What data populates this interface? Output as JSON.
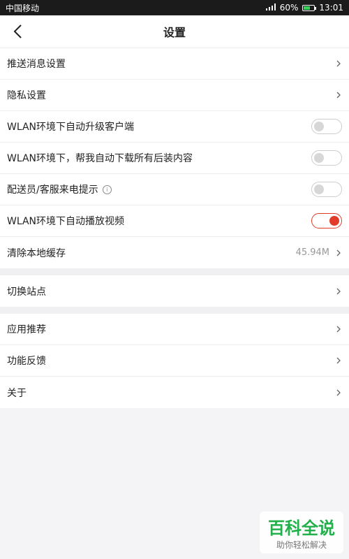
{
  "status": {
    "carrier": "中国移动",
    "battery": "60%",
    "time": "13:01",
    "battery_fill": 0.6
  },
  "header": {
    "title": "设置"
  },
  "group1": [
    {
      "label": "推送消息设置",
      "type": "nav"
    },
    {
      "label": "隐私设置",
      "type": "nav"
    },
    {
      "label": "WLAN环境下自动升级客户端",
      "type": "toggle",
      "on": false
    },
    {
      "label": "WLAN环境下，帮我自动下载所有后装内容",
      "type": "toggle",
      "on": false
    },
    {
      "label": "配送员/客服来电提示",
      "type": "toggle",
      "on": false,
      "info": true
    },
    {
      "label": "WLAN环境下自动播放视频",
      "type": "toggle",
      "on": true
    },
    {
      "label": "清除本地缓存",
      "type": "nav",
      "value": "45.94M"
    }
  ],
  "group2": [
    {
      "label": "切换站点",
      "type": "nav"
    }
  ],
  "group3": [
    {
      "label": "应用推荐",
      "type": "nav"
    },
    {
      "label": "功能反馈",
      "type": "nav"
    },
    {
      "label": "关于",
      "type": "nav"
    }
  ],
  "watermark": {
    "main": "百科全说",
    "sub": "助你轻松解决"
  },
  "colors": {
    "accent": "#e23b2a",
    "brand": "#22b04b"
  }
}
